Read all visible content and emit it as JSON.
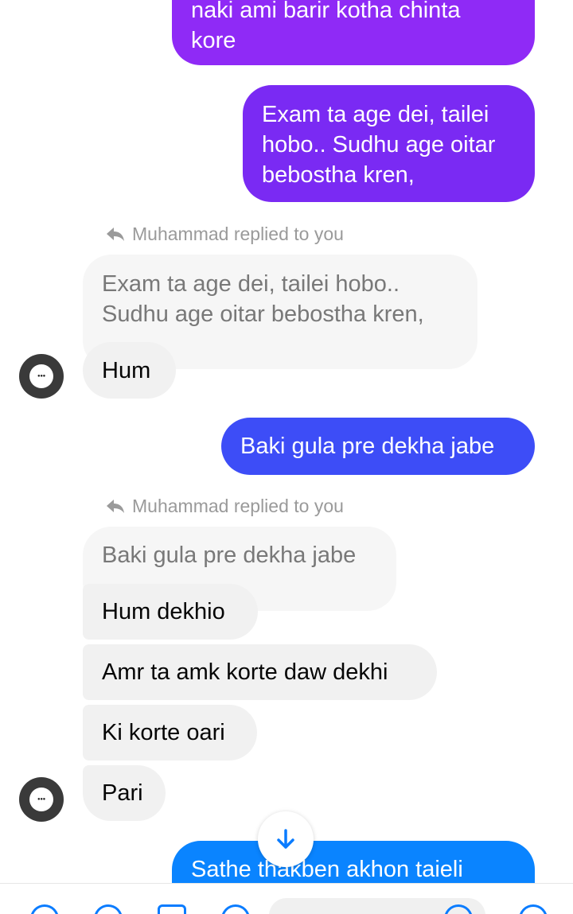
{
  "colors": {
    "sent_purple_1": "#8f2af6",
    "sent_purple_2": "#7a2af3",
    "sent_indigo": "#3d4df7",
    "sent_blue": "#0a84ff",
    "received_bg": "#f1f1f1",
    "accent": "#0a7cff"
  },
  "messages": {
    "m1": "naki ami barir kotha chinta\nkore",
    "m2": "Exam ta age dei,  tailei\nhobo.. Sudhu age oitar\nbebostha kren,",
    "reply1_label": "Muhammad replied to you",
    "reply1_quote": "Exam ta age dei,  tailei hobo..\nSudhu age oitar bebostha kren,",
    "m3": "Hum",
    "m4": "Baki gula pre dekha jabe",
    "reply2_label": "Muhammad replied to you",
    "reply2_quote": "Baki gula pre dekha jabe",
    "m5": "Hum dekhio",
    "m6": "Amr ta amk korte daw dekhi",
    "m7": "Ki korte oari",
    "m8": "Pari",
    "m9": "Sathe thakben akhon taieli"
  },
  "icons": {
    "reply": "reply-arrow-icon",
    "scroll": "arrow-down-icon",
    "avatar": "contact-avatar"
  }
}
